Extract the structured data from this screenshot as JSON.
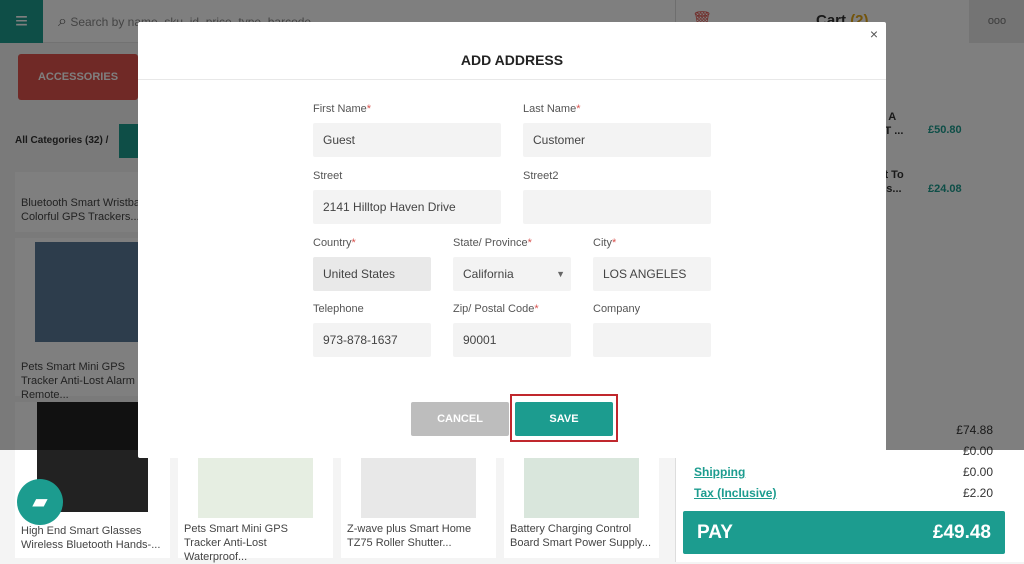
{
  "topbar": {
    "search_placeholder": "Search by name, sku, id, price, type, barcode",
    "cart_title": "Cart",
    "cart_count": "(2)",
    "more": "ooo"
  },
  "categories": {
    "active": "ACCESSORIES",
    "breadcrumb": "All Categories (32)",
    "separator": "/"
  },
  "products": [
    {
      "name": "Bluetooth Smart Wristband Colorful GPS Trackers..."
    },
    {
      "name": "Pets Smart Mini GPS Tracker Anti-Lost Alarm Remote..."
    },
    {
      "name": "High End Smart Glasses Wireless Bluetooth Hands-..."
    },
    {
      "name": "Pets Smart Mini GPS Tracker Anti-Lost Waterproof..."
    },
    {
      "name": "Z-wave plus Smart Home TZ75 Roller Shutter..."
    },
    {
      "name": "Battery Charging Control Board Smart Power Supply..."
    }
  ],
  "cart": {
    "items": [
      {
        "name1": "ort A",
        "name2": "TTT ...",
        "price": "£50.80"
      },
      {
        "name1": "ght To",
        "name2": "lass...",
        "price": "£24.08"
      }
    ],
    "subtotal": "£74.88",
    "discount": "£0.00",
    "shipping_label": "Shipping",
    "shipping": "£0.00",
    "tax_label": "Tax (Inclusive)",
    "tax": "£2.20",
    "pay_label": "PAY",
    "pay_total": "£49.48"
  },
  "modal": {
    "title": "ADD ADDRESS",
    "close": "×",
    "fields": {
      "first_name": {
        "label": "First Name",
        "req": "*",
        "value": "Guest"
      },
      "last_name": {
        "label": "Last Name",
        "req": "*",
        "value": "Customer"
      },
      "street": {
        "label": "Street",
        "value": "2141  Hilltop Haven Drive"
      },
      "street2": {
        "label": "Street2",
        "value": ""
      },
      "country": {
        "label": "Country",
        "req": "*",
        "value": "United States"
      },
      "state": {
        "label": "State/ Province",
        "req": "*",
        "value": "California"
      },
      "city": {
        "label": "City",
        "req": "*",
        "value": "LOS ANGELES"
      },
      "telephone": {
        "label": "Telephone",
        "value": "973-878-1637"
      },
      "zip": {
        "label": "Zip/ Postal Code",
        "req": "*",
        "value": "90001"
      },
      "company": {
        "label": "Company",
        "value": ""
      }
    },
    "cancel": "CANCEL",
    "save": "SAVE"
  },
  "colors": {
    "accent": "#1c9c8f",
    "category": "#e0524c",
    "highlight": "#c0272d"
  }
}
